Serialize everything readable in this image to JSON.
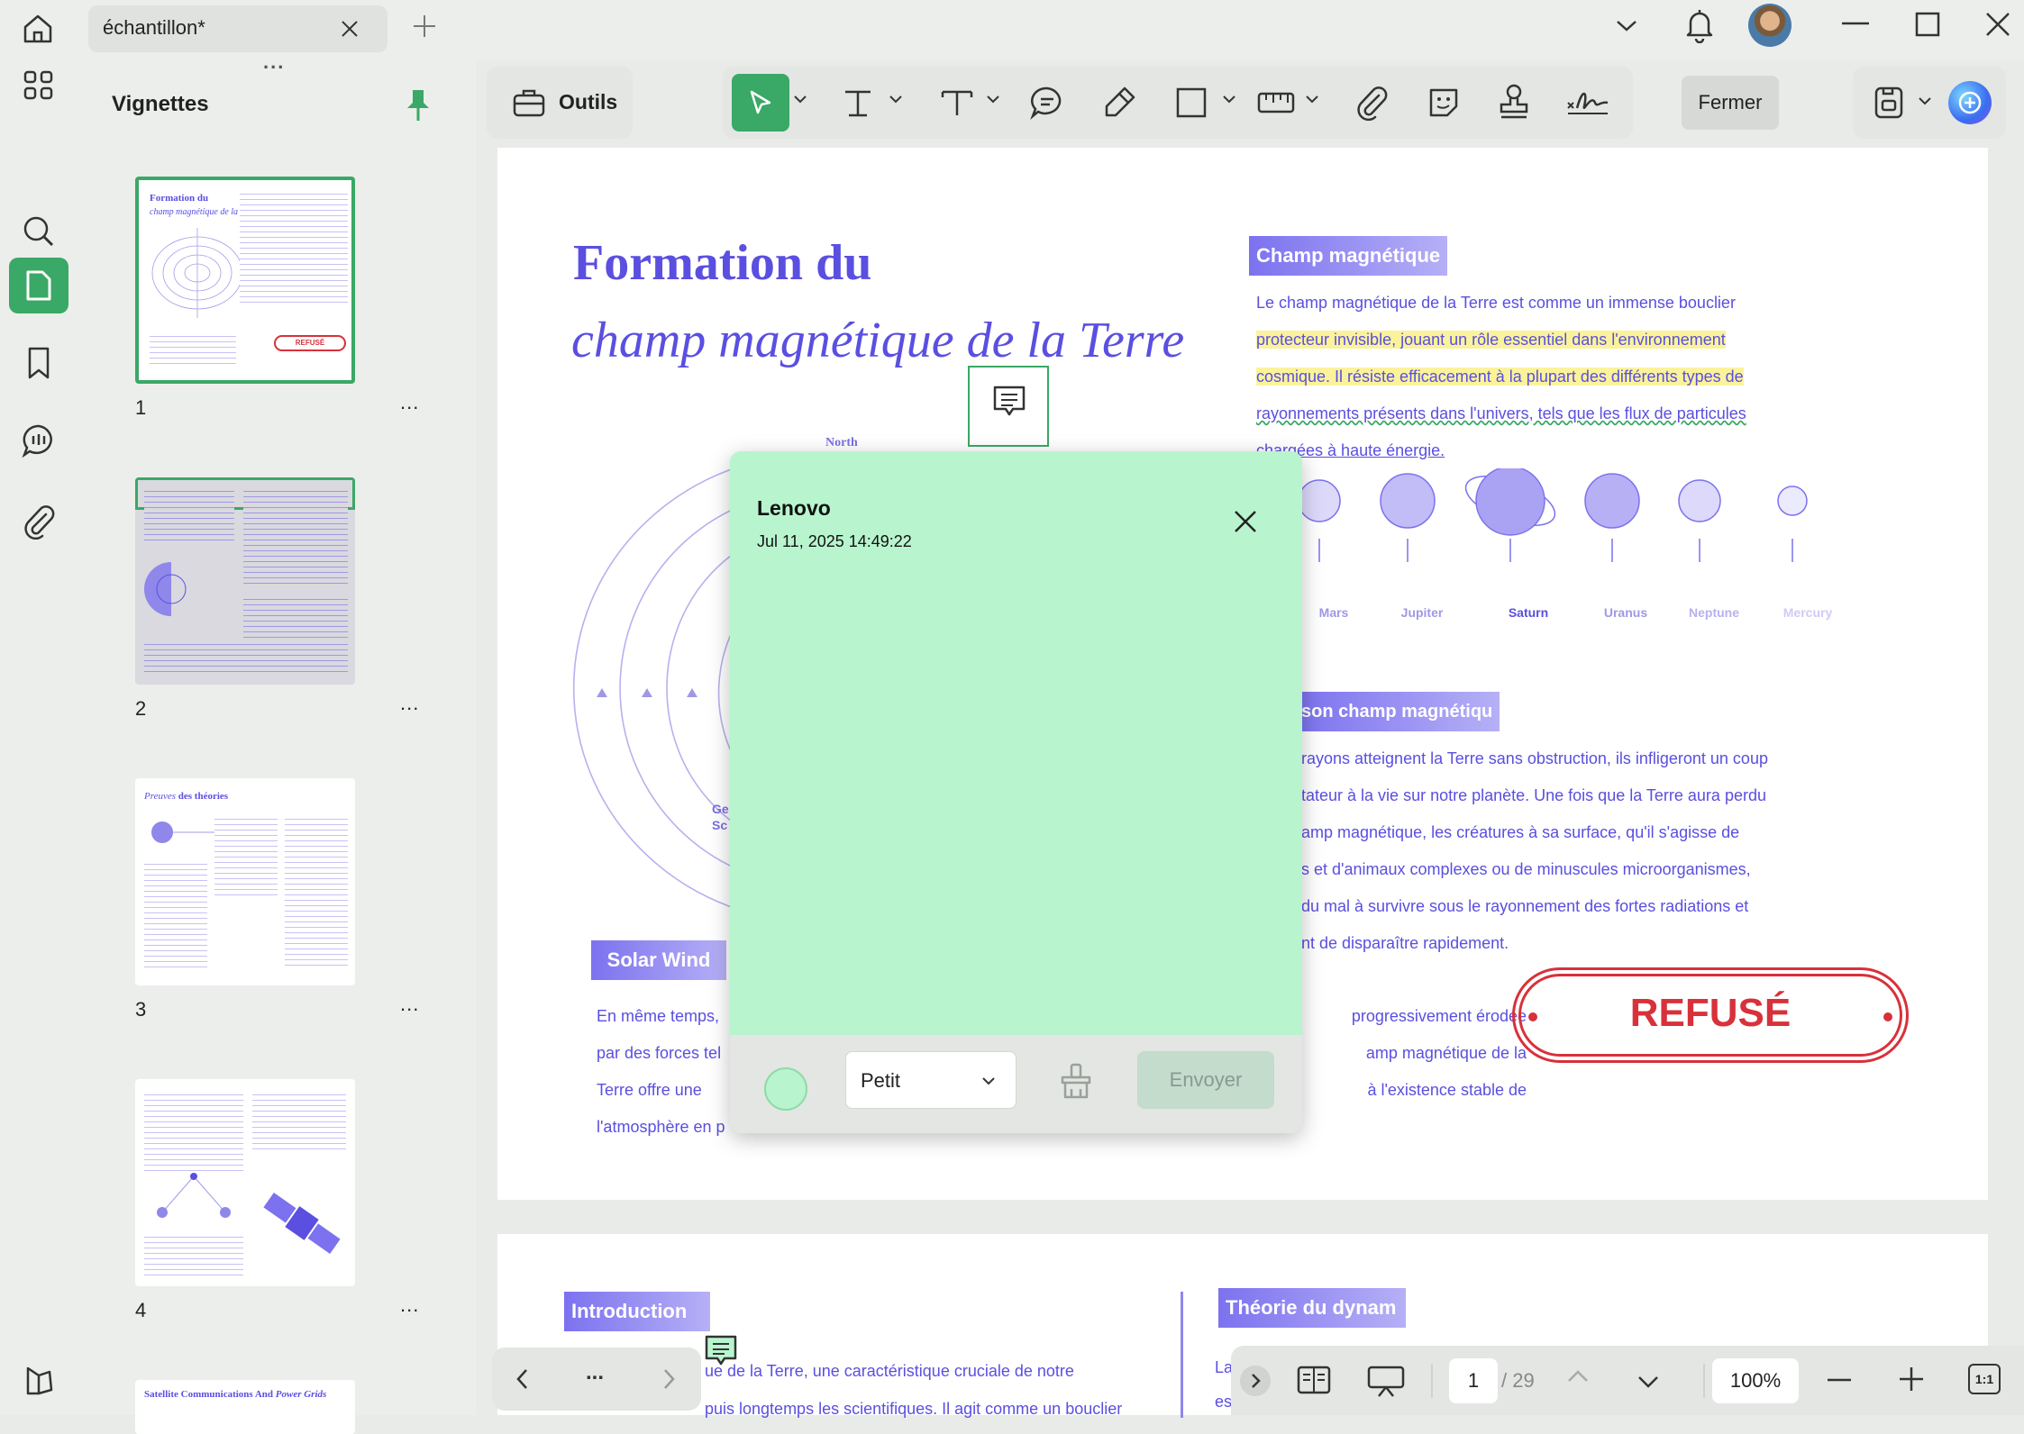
{
  "titlebar": {
    "tab_title": "échantillon*",
    "icons": [
      "home-icon",
      "close-tab-icon",
      "new-tab-icon",
      "chevron-down-icon",
      "bell-icon",
      "avatar",
      "minimize-icon",
      "maximize-icon",
      "close-window-icon"
    ]
  },
  "sidebar": {
    "title": "Vignettes",
    "thumbnails": [
      {
        "number": "1",
        "more": "..."
      },
      {
        "number": "2",
        "more": "..."
      },
      {
        "number": "3",
        "more": "..."
      },
      {
        "number": "4",
        "more": "..."
      }
    ],
    "thumb1": {
      "title1": "Formation du",
      "title2": "champ magnétique de la Terre",
      "stamp": "REFUSÉ"
    },
    "thumb3": {
      "title_italic": "Preuves",
      "title_bold": "des théories"
    },
    "thumb5": {
      "title": "Satellite Communications And",
      "title_italic": "Power Grids"
    },
    "grip": "...",
    "icons": [
      "pin-icon"
    ]
  },
  "rail": {
    "icons": [
      "thumbnails-grid-icon",
      "search-icon",
      "page-icon",
      "bookmark-icon",
      "comment-icon",
      "attachment-icon",
      "theme-icon"
    ]
  },
  "toolbar": {
    "tools_label": "Outils",
    "close_label": "Fermer",
    "icons": [
      "select-icon",
      "text-insert-icon",
      "text-box-icon",
      "comment-icon",
      "highlighter-icon",
      "rectangle-icon",
      "measure-icon",
      "attach-icon",
      "sticker-icon",
      "stamp-icon",
      "signature-icon",
      "save-icon",
      "ai-assistant-icon"
    ]
  },
  "document": {
    "title_line1": "Formation du",
    "title_line2": "champ magnétique de la Terre",
    "diagram_label_north": "North",
    "diagram_label_geo1": "Ge",
    "diagram_label_geo2": "Sc",
    "section1": "Champ magnétique",
    "section1_lines": [
      "Le champ magnétique de la Terre est comme un immense bouclier",
      "protecteur invisible, jouant un rôle essentiel dans l'environnement",
      "cosmique. Il résiste efficacement à la plupart des différents types de",
      "rayonnements présents dans l'univers, tels que les flux de particules",
      "chargées à haute énergie."
    ],
    "planets": [
      "Mars",
      "Jupiter",
      "Saturn",
      "Uranus",
      "Neptune",
      "Mercury"
    ],
    "section2": "son champ magnétiqu",
    "section2_lines": [
      "rayons atteignent la Terre sans obstruction, ils infligeront un coup",
      "tateur à la vie sur notre planète. Une fois que la Terre aura perdu",
      "amp magnétique, les créatures à sa surface, qu'il s'agisse de",
      "s et d'animaux complexes ou de minuscules microorganismes,",
      "du mal à survivre sous le rayonnement des fortes radiations et",
      "nt de disparaître rapidement."
    ],
    "solar_wind": "Solar Wind",
    "solar_lines_left": [
      "En même temps,",
      "par des forces tel",
      "Terre offre une",
      "l'atmosphère en p"
    ],
    "solar_lines_right": [
      "progressivement érodée",
      "amp magnétique de la",
      "à l'existence stable de",
      ""
    ],
    "stamp": "REFUSÉ",
    "page2_intro": "Introduction",
    "page2_theory": "Théorie du dynam",
    "page2_line1": "ue de la Terre, une caractéristique cruciale de notre",
    "page2_line2": "puis longtemps les scientifiques. Il agit comme un bouclier",
    "page2_right1": "La",
    "page2_right2": "es"
  },
  "comment_popup": {
    "author": "Lenovo",
    "timestamp": "Jul 11, 2025 14:49:22",
    "size_label": "Petit",
    "send_label": "Envoyer",
    "color": "#b8f5ce"
  },
  "bottom_nav": {
    "more": "..."
  },
  "statusbar": {
    "page_current": "1",
    "page_total": "/ 29",
    "zoom": "100%",
    "fit_label": "1:1"
  },
  "colors": {
    "accent_green": "#3aa866",
    "doc_purple": "#6b5ee8",
    "stamp_red": "#d8313a",
    "highlight": "#fbf39b"
  }
}
